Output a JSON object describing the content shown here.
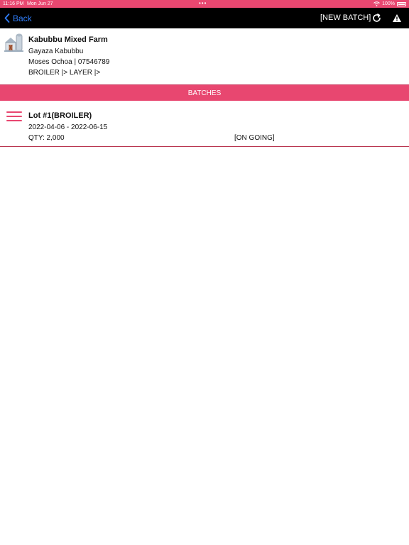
{
  "status_bar": {
    "time": "11:16 PM",
    "date": "Mon Jun 27",
    "dots": "•••",
    "battery": "100%"
  },
  "navbar": {
    "back_label": "Back",
    "new_batch_label": "[NEW BATCH]",
    "icons": [
      "chevron-left-icon",
      "refresh-icon",
      "warning-icon"
    ]
  },
  "farm": {
    "icon": "farm-barn-icon",
    "name": "Kabubbu Mixed Farm",
    "location": "Gayaza Kabubbu",
    "contact": "Moses Ochoa | 07546789",
    "types": "BROILER |> LAYER |>"
  },
  "section": {
    "title": "BATCHES"
  },
  "batches": [
    {
      "lot": "Lot #1(BROILER)",
      "dates": "2022-04-06 - 2022-06-15",
      "qty": "QTY: 2,000",
      "status": "[ON GOING]"
    }
  ],
  "colors": {
    "accent": "#e84770",
    "navbar": "#000000",
    "link": "#2f7cf6"
  }
}
